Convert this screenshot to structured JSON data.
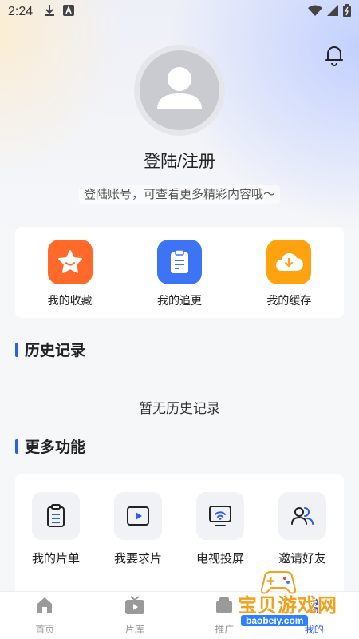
{
  "status_bar": {
    "time": "2:24",
    "left_icons": [
      "download-icon",
      "a-box-icon"
    ],
    "right_icons": [
      "wifi-icon",
      "signal-icon",
      "battery-icon"
    ]
  },
  "profile": {
    "login_title": "登陆/注册",
    "login_subtitle": "登陆账号，可查看更多精彩内容哦～"
  },
  "quick_actions": [
    {
      "label": "我的收藏",
      "icon": "star-icon",
      "color": "#ff6a2b"
    },
    {
      "label": "我的追更",
      "icon": "clipboard-icon",
      "color": "#3d74f5"
    },
    {
      "label": "我的缓存",
      "icon": "cloud-download-icon",
      "color": "#ffa20f"
    }
  ],
  "history": {
    "title": "历史记录",
    "empty_text": "暂无历史记录"
  },
  "more_functions": {
    "title": "更多功能",
    "items": [
      {
        "label": "我的片单",
        "icon": "list-clipboard-icon"
      },
      {
        "label": "我要求片",
        "icon": "play-request-icon"
      },
      {
        "label": "电视投屏",
        "icon": "cast-screen-icon"
      },
      {
        "label": "邀请好友",
        "icon": "invite-friends-icon"
      }
    ]
  },
  "bottom_nav": [
    {
      "label": "首页",
      "icon": "home-icon",
      "active": false
    },
    {
      "label": "片库",
      "icon": "library-icon",
      "active": false
    },
    {
      "label": "推广",
      "icon": "promo-icon",
      "active": false
    },
    {
      "label": "我的",
      "icon": "profile-icon",
      "active": true
    }
  ],
  "watermark": {
    "text": "宝贝游戏网",
    "url": "baobeiy.com"
  },
  "colors": {
    "accent": "#2f5cf5",
    "inactive_nav": "#999999"
  }
}
